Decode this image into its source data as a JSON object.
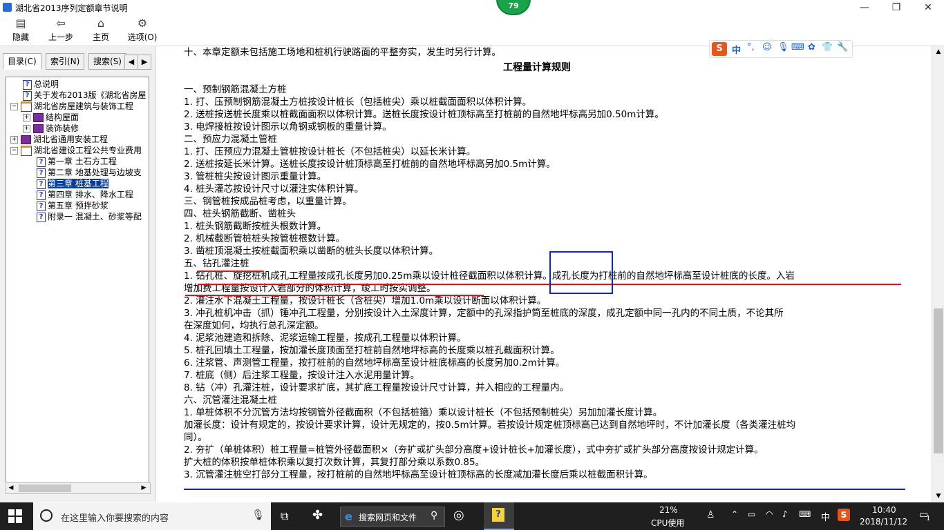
{
  "window": {
    "title": "湖北省2013序列定额章节说明",
    "minimize": "—",
    "maximize": "❐",
    "close": "✕"
  },
  "badge": "79",
  "toolbar": {
    "hide": "隐藏",
    "back": "上一步",
    "home": "主页",
    "options": "选项(O)"
  },
  "left_tabs": {
    "contents": "目录(C)",
    "index": "索引(N)",
    "search": "搜索(S)"
  },
  "tree": [
    {
      "label": "总说明"
    },
    {
      "label": "关于发布2013版《湖北省房屋"
    },
    {
      "label": "湖北省房屋建筑与装饰工程"
    },
    {
      "label": "结构屋面"
    },
    {
      "label": "装饰装修"
    },
    {
      "label": "湖北省通用安装工程"
    },
    {
      "label": "湖北省建设工程公共专业费用"
    },
    {
      "label": "第一章 土石方工程"
    },
    {
      "label": "第二章 地基处理与边坡支"
    },
    {
      "label": "第三章 桩基工程"
    },
    {
      "label": "第四章 排水、降水工程"
    },
    {
      "label": "第五章 预拌砂浆"
    },
    {
      "label": "附录一 混凝土、砂浆等配"
    }
  ],
  "ime": {
    "lang": "中"
  },
  "content": {
    "intro": "十、本章定额未包括施工场地和桩机行驶路面的平整夯实，发生时另行计算。",
    "heading": "工程量计算规则",
    "lines": [
      "一、预制钢筋混凝土方桩",
      "1. 打、压预制钢筋混凝土方桩按设计桩长（包括桩尖）乘以桩截面面积以体积计算。",
      "2. 送桩按送桩长度乘以桩截面面积以体积计算。送桩长度按设计桩顶标高至打桩前的自然地坪标高另加0.50m计算。",
      "3. 电焊接桩按设计图示以角钢或钢板的重量计算。",
      "二、预应力混凝土管桩",
      "1. 打、压预应力混凝土管桩按设计桩长（不包括桩尖）以延长米计算。",
      "2. 送桩按延长米计算。送桩长度按设计桩顶标高至打桩前的自然地坪标高另加0.5m计算。",
      "3. 管桩桩尖按设计图示重量计算。",
      "4. 桩头灌芯按设计尺寸以灌注实体积计算。",
      "三、钢管桩按成品桩考虑，以重量计算。",
      "四、桩头钢筋截断、凿桩头",
      "1. 桩头钢筋截断按桩头根数计算。",
      "2. 机械截断管桩桩头按管桩根数计算。",
      "3. 凿桩顶混凝土按桩截面积乘以凿断的桩头长度以体积计算。",
      "五、钻孔灌注桩",
      "1. 钻孔桩、旋挖桩机成孔工程量按成孔长度另加0.25m乘以设计桩径截面积以体积计算。成孔长度为打桩前的自然地坪标高至设计桩底的长度。入岩",
      "增加费工程量按设计入岩部分的体积计算，竣工时按实调整。",
      "2. 灌注水下混凝土工程量，按设计桩长（含桩尖）增加1.0m乘以设计断面以体积计算。",
      "3. 冲孔桩机冲击（抓）锤冲孔工程量，分别按设计入土深度计算，定额中的孔深指护筒至桩底的深度，成孔定额中同一孔内的不同土质，不论其所",
      "在深度如何，均执行总孔深定额。",
      "4. 泥浆池建造和拆除、泥浆运输工程量，按成孔工程量以体积计算。",
      "5. 桩孔回填土工程量，按加灌长度顶面至打桩前自然地坪标高的长度乘以桩孔截面积计算。",
      "6. 注浆管、声测管工程量，按打桩前的自然地坪标高至设计桩底标高的长度另加0.2m计算。",
      "7. 桩底（侧）后注浆工程量，按设计注入水泥用量计算。",
      "8. 钻（冲）孔灌注桩，设计要求扩底，其扩底工程量按设计尺寸计算，并入相应的工程量内。",
      "六、沉管灌注混凝土桩",
      "1. 单桩体积不分沉管方法均按钢管外径截面积（不包括桩箍）乘以设计桩长（不包括预制桩尖）另加加灌长度计算。",
      "加灌长度：设计有规定的，按设计要求计算，设计无规定的，按0.5m计算。若按设计规定桩顶标高已达到自然地坪时，不计加灌长度（各类灌注桩均",
      "同）。",
      "2. 夯扩（单桩体积）桩工程量=桩管外径截面积×（夯扩或扩头部分高度+设计桩长+加灌长度），式中夯扩或扩头部分高度按设计规定计算。",
      "扩大桩的体积按单桩体积乘以复打次数计算，其复打部分乘以系数0.85。",
      "3. 沉管灌注桩空打部分工程量，按打桩前的自然地坪标高至设计桩顶标高的长度减加灌长度后乘以桩截面积计算。"
    ]
  },
  "taskbar": {
    "search_placeholder": "在这里输入你要搜索的内容",
    "browser_search": "搜索网页和文件",
    "cpu_percent": "21%",
    "cpu_label": "CPU使用",
    "ime": "中",
    "time": "10:40",
    "date": "2018/11/12",
    "notifications": "1"
  },
  "colors": {
    "selection": "#0a3c96",
    "annotation_red": "#e0101a",
    "annotation_blue": "#1020d8",
    "taskbar": "#1f1f1f"
  }
}
